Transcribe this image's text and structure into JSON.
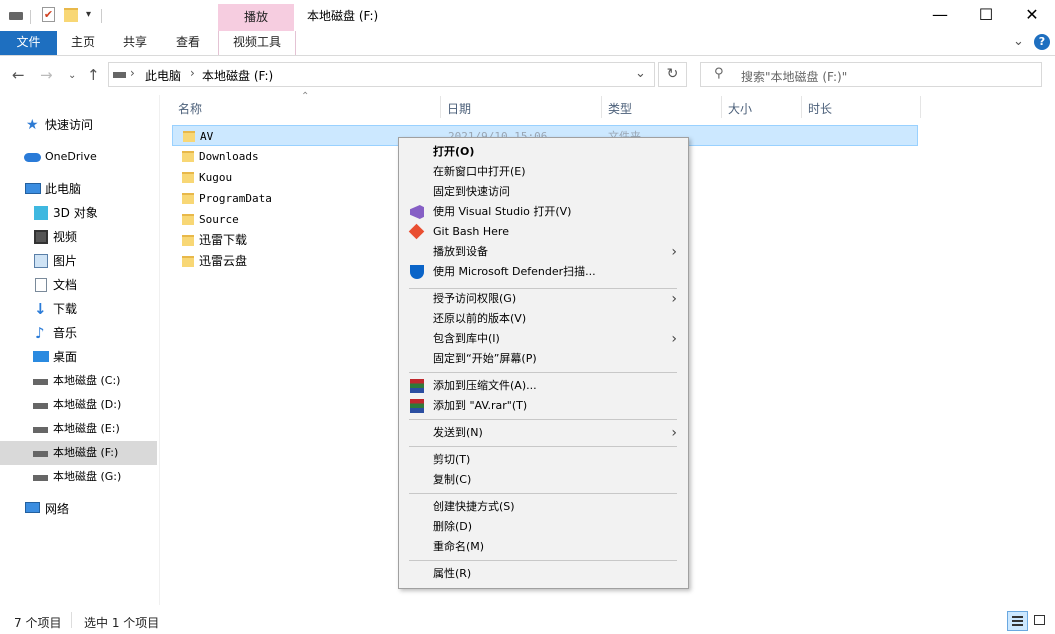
{
  "window": {
    "title": "本地磁盘 (F:)",
    "contextual_tab_group": "播放",
    "minimize_glyph": "—",
    "maximize_glyph": "☐",
    "close_glyph": "✕"
  },
  "ribbon": {
    "tabs": [
      "文件",
      "主页",
      "共享",
      "查看",
      "视频工具"
    ],
    "help_glyph": "?",
    "collapse_glyph": "⌄"
  },
  "address": {
    "path": [
      "此电脑",
      "本地磁盘 (F:)"
    ],
    "separator": "›",
    "search_placeholder": "搜索\"本地磁盘 (F:)\""
  },
  "nav": {
    "quick_access": "快速访问",
    "onedrive": "OneDrive",
    "this_pc": "此电脑",
    "items": [
      "3D 对象",
      "视频",
      "图片",
      "文档",
      "下载",
      "音乐",
      "桌面",
      "本地磁盘 (C:)",
      "本地磁盘 (D:)",
      "本地磁盘 (E:)",
      "本地磁盘 (F:)",
      "本地磁盘 (G:)"
    ],
    "network": "网络",
    "selected": "本地磁盘 (F:)"
  },
  "columns": [
    "名称",
    "日期",
    "类型",
    "大小",
    "时长"
  ],
  "files": [
    {
      "name": "AV",
      "date": "2021/9/10 15:06",
      "type": "文件夹"
    },
    {
      "name": "Downloads"
    },
    {
      "name": "Kugou"
    },
    {
      "name": "ProgramData"
    },
    {
      "name": "Source"
    },
    {
      "name": "迅雷下载"
    },
    {
      "name": "迅雷云盘"
    }
  ],
  "context_menu": {
    "group1": [
      "打开(O)",
      "在新窗口中打开(E)",
      "固定到快速访问",
      "使用 Visual Studio 打开(V)",
      "Git Bash Here",
      "播放到设备",
      "使用 Microsoft Defender扫描..."
    ],
    "group2": [
      "授予访问权限(G)",
      "还原以前的版本(V)",
      "包含到库中(I)",
      "固定到“开始”屏幕(P)"
    ],
    "group3": [
      "添加到压缩文件(A)...",
      "添加到 \"AV.rar\"(T)"
    ],
    "group4": [
      "发送到(N)"
    ],
    "group5": [
      "剪切(T)",
      "复制(C)"
    ],
    "group6": [
      "创建快捷方式(S)",
      "删除(D)",
      "重命名(M)"
    ],
    "group7": [
      "属性(R)"
    ],
    "submenu_arrow": "›"
  },
  "status": {
    "count": "7 个项目",
    "selected": "选中 1 个项目"
  },
  "colors": {
    "file_tab": "#1e6fc0",
    "contextual": "#f6cde0",
    "selection": "#cce8ff",
    "nav_selected": "#d9d9d9"
  }
}
